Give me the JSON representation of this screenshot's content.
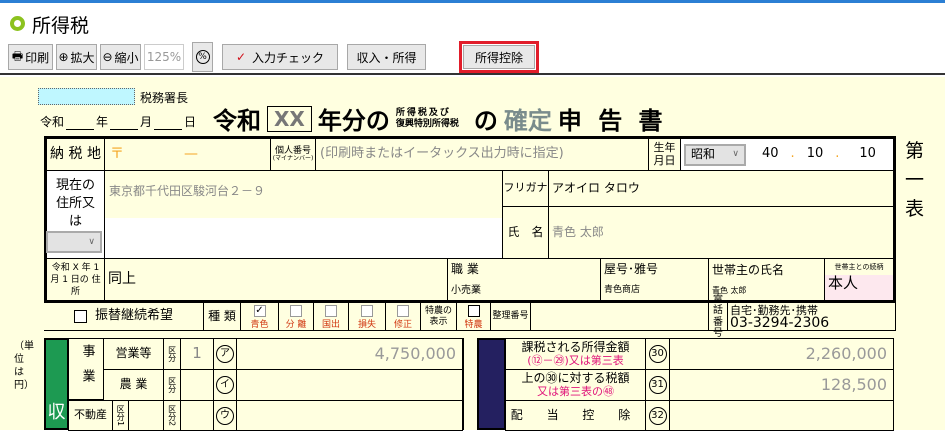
{
  "window": {
    "title": "所得税"
  },
  "toolbar": {
    "print": "印刷",
    "zoom_in": "拡大",
    "zoom_out": "縮小",
    "zoom_level": "125%",
    "zoom_fit": "%",
    "input_check": "入力チェック",
    "income": "収入・所得",
    "deduction": "所得控除"
  },
  "header": {
    "tax_office_suffix": "税務署長",
    "tax_office": "",
    "date_label": {
      "era": "令和",
      "year": "年",
      "month": "月",
      "day": "日"
    },
    "title_era": "令和",
    "title_year": "XX",
    "title_mid": "年分の",
    "title_small_1": "所得税及び",
    "title_small_2": "復興特別所得税",
    "title_no": "の",
    "title_kakutei": "確定",
    "title_end": "申 告 書",
    "side": "第一表"
  },
  "row1": {
    "label": "納 税 地",
    "postal_mark": "〒",
    "postal_dash": "—",
    "mynumber_label": "個人番号",
    "mynumber_sub": "(マイナンバー)",
    "mynumber_note": "(印刷時またはイータックス出力時に指定)",
    "birth_label": "生年月日",
    "era": "昭和",
    "birth_y": "40",
    "birth_m": "10",
    "birth_d": "10",
    "sep": "."
  },
  "row2": {
    "label": "現在の住所又は",
    "address": "東京都千代田区駿河台２－９",
    "furigana_label": "フリガナ",
    "furigana": "アオイロ タロウ",
    "name_label": "氏　名",
    "name": "青色 太郎"
  },
  "row3": {
    "label": "令和 X 年 1 月 1 日の 住 所",
    "address": "同上",
    "job_label": "職 業",
    "job": "小売業",
    "shop_label": "屋号･雅号",
    "shop": "青色商店",
    "head_label": "世帯主の氏名",
    "head": "青色 太郎",
    "relation_label": "世帯主との続柄",
    "relation": "本人"
  },
  "row4": {
    "transfer": "振替継続希望",
    "kind_label": "種 類",
    "kinds": [
      {
        "label": "青色",
        "checked": true
      },
      {
        "label": "分 離",
        "checked": false
      },
      {
        "label": "国出",
        "checked": false
      },
      {
        "label": "損失",
        "checked": false
      },
      {
        "label": "修正",
        "checked": false
      }
    ],
    "tokuno_disp": "特農の表示",
    "tokuno": "特農",
    "seiri": "整理番号",
    "phone_label": "電話番号",
    "phone_type": "自宅･勤務先･携帯",
    "phone": "03-3294-2306"
  },
  "income": {
    "unit": "（単位は円）",
    "section": "収",
    "jigyo": "事業",
    "rows": [
      {
        "label": "営業等",
        "kubun": "区分",
        "kubun_val": "1",
        "mark": "ア",
        "amount": "4,750,000"
      },
      {
        "label": "農 業",
        "kubun": "区分",
        "kubun_val": "",
        "mark": "イ",
        "amount": ""
      },
      {
        "label": "不動産",
        "kubun1": "区分1",
        "kubun": "区分2",
        "kubun_val": "",
        "mark": "ウ",
        "amount": ""
      }
    ]
  },
  "tax": {
    "rows": [
      {
        "label": "課税される所得金額",
        "sub": "(⑫－㉙)又は第三表",
        "mark": "30",
        "amount": "2,260,000"
      },
      {
        "label": "上の㉚に対する税額",
        "sub": "又は第三表の㊽",
        "mark": "31",
        "amount": "128,500"
      },
      {
        "label": "配 当 控 除",
        "sub": "",
        "mark": "32",
        "amount": ""
      }
    ]
  }
}
